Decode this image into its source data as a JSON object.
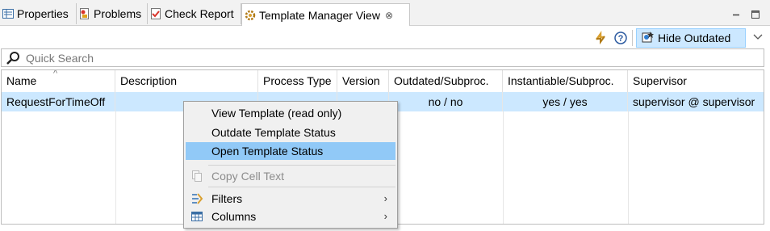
{
  "tabs": [
    {
      "label": "Properties",
      "icon": "properties-icon"
    },
    {
      "label": "Problems",
      "icon": "problems-icon"
    },
    {
      "label": "Check Report",
      "icon": "check-report-icon"
    },
    {
      "label": "Template Manager View",
      "icon": "template-manager-icon",
      "close": "⊗"
    }
  ],
  "toolbar": {
    "refresh_icon": "sync-icon",
    "help_icon": "help-icon",
    "hide_outdated_label": "Hide Outdated",
    "menu_icon": "view-menu-chevron-icon"
  },
  "search": {
    "placeholder": "Quick Search",
    "value": ""
  },
  "table": {
    "columns": [
      "Name",
      "Description",
      "Process Type",
      "Version",
      "Outdated/Subproc.",
      "Instantiable/Subproc.",
      "Supervisor"
    ],
    "sorted_column": "Name",
    "rows": [
      {
        "name": "RequestForTimeOff",
        "description": "",
        "process_type": "",
        "version": "",
        "outdated": "no / no",
        "instantiable": "yes / yes",
        "supervisor": "supervisor @ supervisor"
      }
    ]
  },
  "context_menu": {
    "items": [
      {
        "label": "View Template (read only)"
      },
      {
        "label": "Outdate Template Status"
      },
      {
        "label": "Open Template Status",
        "highlighted": true
      },
      {
        "label": "Copy Cell Text",
        "disabled": true,
        "icon": "copy-icon"
      },
      {
        "label": "Filters",
        "icon": "filter-icon",
        "submenu_arrow": "›"
      },
      {
        "label": "Columns",
        "icon": "columns-icon",
        "submenu_arrow": "›"
      }
    ]
  },
  "colors": {
    "selection": "#cce8ff",
    "menu_highlight": "#91c9f7",
    "menu_background": "#f0f0f0",
    "tabbar_background": "#f2f2f2"
  }
}
